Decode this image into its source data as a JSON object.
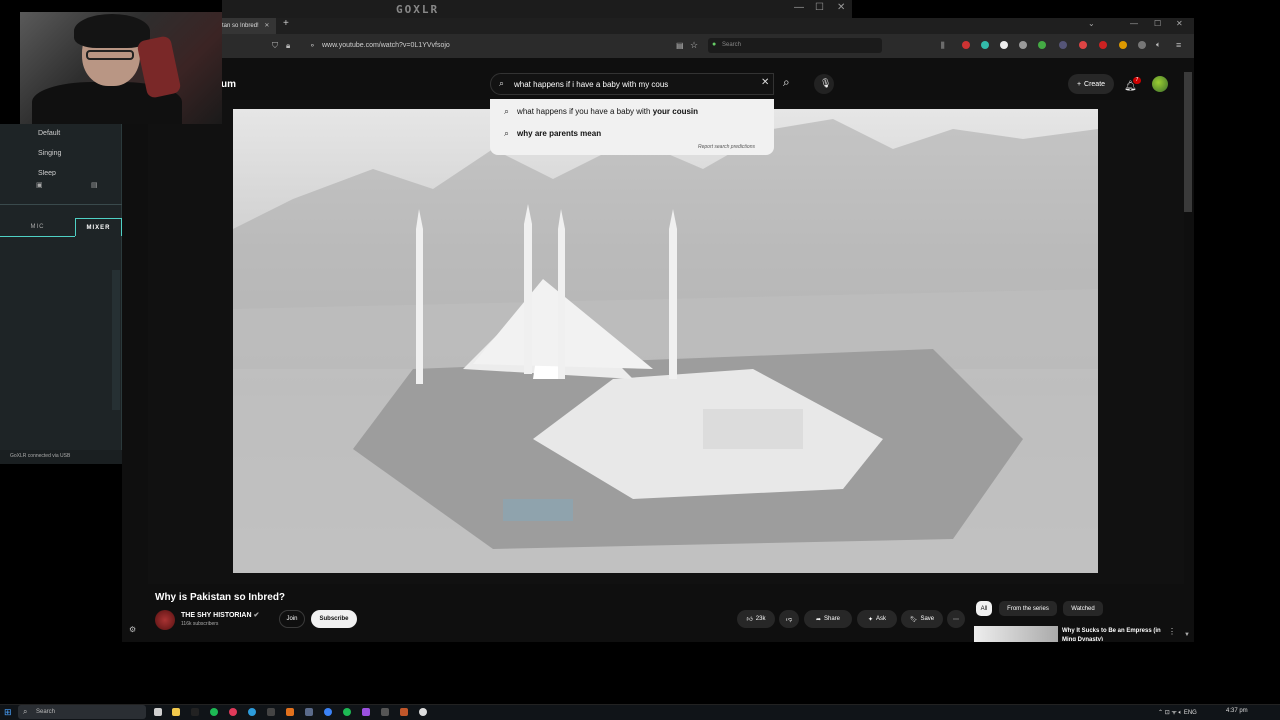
{
  "goxlr": {
    "title": "GOXLR",
    "presets": [
      "Default",
      "Singing",
      "Sleep"
    ],
    "tabs": [
      "MIC",
      "MIXER"
    ],
    "status": "GoXLR connected via USB"
  },
  "browser": {
    "tab_title": "tan so Inbred!",
    "url": "www.youtube.com/watch?v=0L1YVvfsojo",
    "search_placeholder": "Search"
  },
  "youtube": {
    "logo": "um",
    "search_value": "what happens if i have a baby with my cous",
    "suggestions": [
      {
        "typed": "what happens if you have a baby with ",
        "completion": "your cousin"
      },
      {
        "typed": "",
        "completion": "why are parents mean"
      }
    ],
    "report_link": "Report search predictions",
    "create_label": "Create",
    "notification_count": "7"
  },
  "video": {
    "title": "Why is Pakistan so Inbred?",
    "channel": "THE SHY HISTORIAN",
    "subscribers": "116k subscribers",
    "join_label": "Join",
    "subscribe_label": "Subscribe",
    "likes": "23k",
    "share_label": "Share",
    "ask_label": "Ask",
    "save_label": "Save"
  },
  "sidebar": {
    "chips": [
      "All",
      "From the series",
      "Watched"
    ],
    "recommended_title": "Why It Sucks to Be an Empress (in Ming Dynasty)"
  },
  "taskbar": {
    "search_placeholder": "Search",
    "lang": "ENG",
    "time": "4:37 pm"
  }
}
